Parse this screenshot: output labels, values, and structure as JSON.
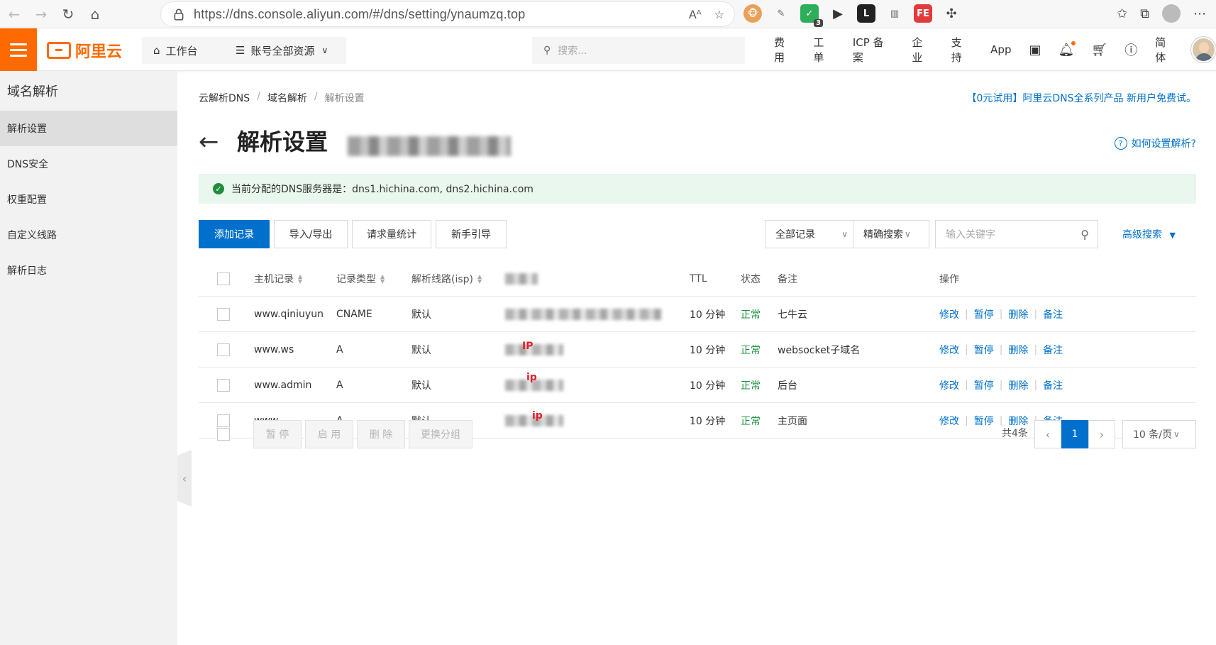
{
  "browser": {
    "url": "https://dns.console.aliyun.com/#/dns/setting/ynaumzq.top",
    "ext_badge": "3"
  },
  "header": {
    "logo_text": "阿里云",
    "workbench": "工作台",
    "resources": "账号全部资源",
    "search_placeholder": "搜索...",
    "nav": [
      "费用",
      "工单",
      "ICP 备案",
      "企业",
      "支持",
      "App"
    ],
    "lang": "简体",
    "accent": "#ff6a00"
  },
  "sidebar": {
    "title": "域名解析",
    "items": [
      "解析设置",
      "DNS安全",
      "权重配置",
      "自定义线路",
      "解析日志"
    ]
  },
  "breadcrumb": [
    "云解析DNS",
    "域名解析",
    "解析设置"
  ],
  "promo": "【0元试用】阿里云DNS全系列产品 新用户免费试。",
  "page_title": "解析设置",
  "help_link": "如何设置解析?",
  "notice": "当前分配的DNS服务器是：dns1.hichina.com, dns2.hichina.com",
  "toolbar": {
    "add": "添加记录",
    "import_export": "导入/导出",
    "stats": "请求量统计",
    "guide": "新手引导",
    "filter": "全部记录",
    "search_mode": "精确搜索",
    "keyword_placeholder": "输入关键字",
    "advanced": "高级搜索"
  },
  "table": {
    "columns": [
      "主机记录",
      "记录类型",
      "解析线路(isp)",
      "TTL",
      "状态",
      "备注",
      "操作"
    ],
    "rows": [
      {
        "host": "www.qiniuyun",
        "type": "CNAME",
        "line": "默认",
        "value_mark": "",
        "ttl": "10 分钟",
        "status": "正常",
        "note": "七牛云"
      },
      {
        "host": "www.ws",
        "type": "A",
        "line": "默认",
        "value_mark": "IP",
        "ttl": "10 分钟",
        "status": "正常",
        "note": "websocket子域名"
      },
      {
        "host": "www.admin",
        "type": "A",
        "line": "默认",
        "value_mark": "ip",
        "ttl": "10 分钟",
        "status": "正常",
        "note": "后台"
      },
      {
        "host": "www",
        "type": "A",
        "line": "默认",
        "value_mark": "ip",
        "ttl": "10 分钟",
        "status": "正常",
        "note": "主页面"
      }
    ],
    "actions": [
      "修改",
      "暂停",
      "删除",
      "备注"
    ]
  },
  "footer": {
    "bulk": [
      "暂 停",
      "启 用",
      "删 除",
      "更换分组"
    ],
    "total": "共4条",
    "page": "1",
    "page_size": "10 条/页"
  }
}
